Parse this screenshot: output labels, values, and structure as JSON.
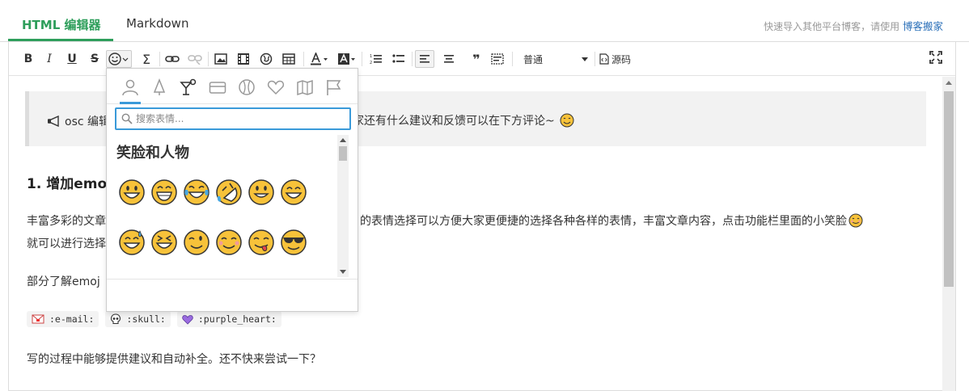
{
  "tabs": [
    {
      "label": "HTML 编辑器",
      "active": true
    },
    {
      "label": "Markdown",
      "active": false
    }
  ],
  "import_hint": {
    "text": "快速导入其他平台博客，请使用",
    "link": "博客搬家"
  },
  "toolbar": {
    "bold": "B",
    "italic": "I",
    "underline": "U",
    "strike": "S",
    "formula": "Σ",
    "quote": "❞",
    "heading_select": "普通",
    "source": "源码"
  },
  "emoji_panel": {
    "search_placeholder": "搜索表情...",
    "category_title": "笑脸和人物",
    "categories": [
      "person-icon",
      "bell-icon",
      "cocktail-icon",
      "card-icon",
      "ball-icon",
      "heart-icon",
      "map-icon",
      "flag-icon"
    ]
  },
  "content": {
    "notice_prefix": "osc 编辑",
    "notice_suffix": "家还有什么建议和反馈可以在下方评论~",
    "heading": "1. 增加emo",
    "para1_left": "丰富多彩的文章",
    "para1_right": "的表情选择可以方便大家更便捷的选择各种各样的表情，丰富文章内容，点击功能栏里面的小笑脸",
    "para1_line2": "就可以进行选择",
    "para2": "部分了解emoj",
    "chips": [
      ":e-mail:",
      ":skull:",
      ":purple_heart:"
    ],
    "para3": "写的过程中能够提供建议和自动补全。还不快来尝试一下？"
  },
  "colors": {
    "accent_green": "#2e9e5b",
    "accent_blue": "#3a9ad9",
    "link_blue": "#2a6fb8"
  }
}
